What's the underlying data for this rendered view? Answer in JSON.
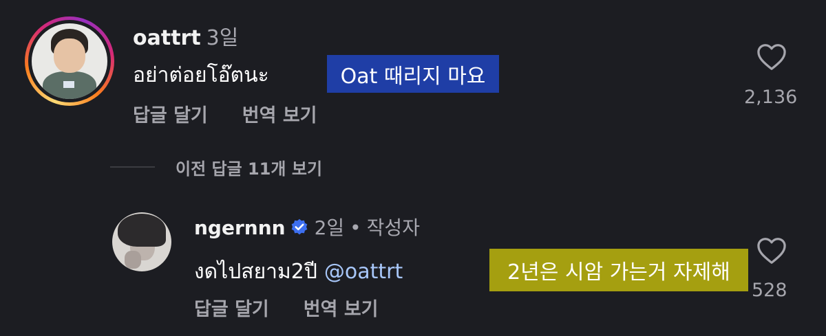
{
  "comment": {
    "username": "oattrt",
    "time": "3일",
    "text": "อย่าต่อยโอ๊ตนะ",
    "translation_highlight": "Oat 때리지 마요",
    "actions": [
      "답글 달기",
      "번역 보기"
    ],
    "likes": "2,136",
    "highlight_color": "#1f3ea6"
  },
  "view_replies": "이전 답글 11개 보기",
  "reply": {
    "username": "ngernnn",
    "verified": true,
    "time": "2일",
    "separator": "•",
    "author_tag": "작성자",
    "text": "งดไปสยาม2ปี",
    "mention": "@oattrt",
    "translation_highlight": "2년은 시암 가는거 자제해",
    "actions": [
      "답글 달기",
      "번역 보기"
    ],
    "likes": "528",
    "highlight_color": "#a59f10"
  },
  "icons": [
    "heart-icon",
    "verified-badge-icon"
  ]
}
